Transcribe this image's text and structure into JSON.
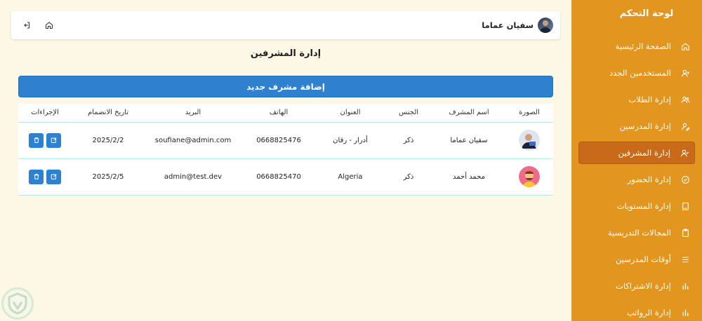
{
  "sidebar": {
    "title": "لوحة التحكم",
    "items": [
      {
        "label": "الصفحة الرئيسية",
        "icon": "home-icon",
        "active": false
      },
      {
        "label": "المستخدمين الجدد",
        "icon": "user-plus-icon",
        "active": false
      },
      {
        "label": "إدارة الطلاب",
        "icon": "users-icon",
        "active": false
      },
      {
        "label": "إدارة المدرسين",
        "icon": "user-pen-icon",
        "active": false
      },
      {
        "label": "إدارة المشرفين",
        "icon": "user-check-icon",
        "active": true
      },
      {
        "label": "إدارة الحضور",
        "icon": "check-circle-icon",
        "active": false
      },
      {
        "label": "إدارة المستويات",
        "icon": "book-icon",
        "active": false
      },
      {
        "label": "المجالات التدريسية",
        "icon": "clipboard-icon",
        "active": false
      },
      {
        "label": "أوقات المدرسين",
        "icon": "menu-icon",
        "active": false
      },
      {
        "label": "إدارة الاشتراكات",
        "icon": "bar-chart-icon",
        "active": false
      },
      {
        "label": "إدارة الرواتب",
        "icon": "bar-chart-icon",
        "active": false
      }
    ]
  },
  "header": {
    "user_name": "سفيان عماما",
    "home_icon": "home-icon",
    "logout_icon": "logout-icon"
  },
  "main": {
    "title": "إدارة المشرفين",
    "add_button": "إضافة مشرف جديد",
    "columns": [
      "الصورة",
      "اسم المشرف",
      "الجنس",
      "العنوان",
      "الهاتف",
      "البريد",
      "تاريخ الانضمام",
      "الإجراءات"
    ],
    "rows": [
      {
        "name": "سفيان عماما",
        "gender": "ذكر",
        "address": "أدرار - رقان",
        "phone": "0668825476",
        "email": "soufiane@admin.com",
        "joined": "2025/2/2"
      },
      {
        "name": "محمد أحمد",
        "gender": "ذكر",
        "address": "Algeria",
        "phone": "0668825470",
        "email": "admin@test.dev",
        "joined": "2025/2/5"
      }
    ]
  },
  "colors": {
    "sidebar": "#e2961f",
    "sidebar_active": "#c96a1a",
    "primary": "#2f81cf",
    "background": "#fdf8e6"
  }
}
